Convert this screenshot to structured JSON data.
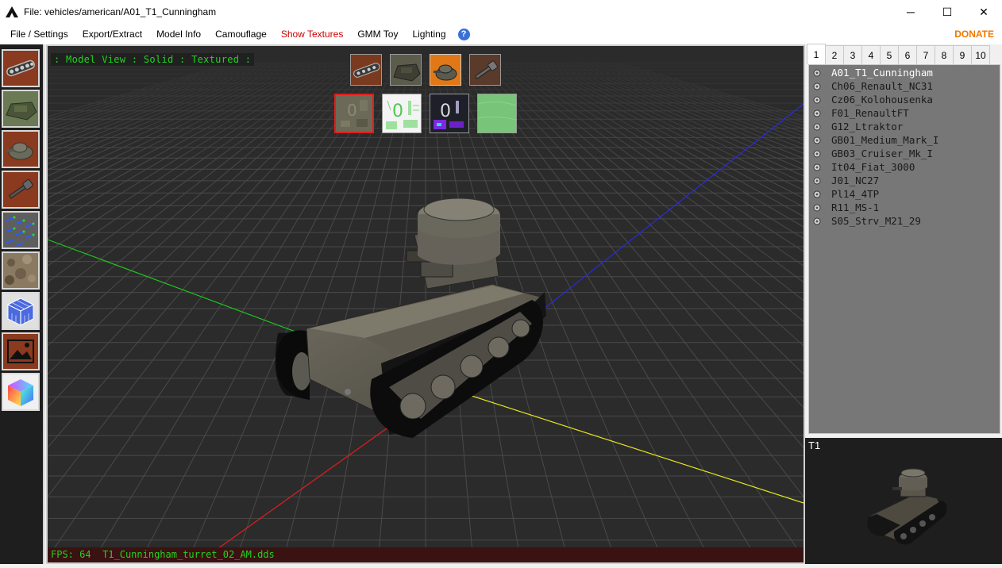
{
  "window": {
    "title": "File: vehicles/american/A01_T1_Cunningham",
    "minimize": "─",
    "maximize": "☐",
    "close": "✕"
  },
  "menu": {
    "items": [
      "File / Settings",
      "Export/Extract",
      "Model Info",
      "Camouflage",
      "Show Textures",
      "GMM Toy",
      "Lighting"
    ],
    "active": "Show Textures",
    "help_glyph": "?",
    "donate": "DONATE"
  },
  "toolbar": {
    "buttons": [
      "chassis-icon",
      "hull-icon",
      "turret-icon",
      "gun-icon",
      "normals-icon",
      "terrain-icon",
      "cube-grid-icon",
      "picture-icon",
      "color-cube-icon"
    ]
  },
  "viewport": {
    "mode_label": ": Model View : Solid : Textured :",
    "fps_label": "FPS:",
    "fps_value": "64",
    "texture_file": "T1_Cunningham_turret_02_AM.dds",
    "part_thumbs": [
      "chassis-thumb",
      "hull-thumb",
      "turret-thumb",
      "gun-thumb"
    ],
    "texture_thumbs": [
      "diffuse-texture",
      "normal-texture",
      "gmm-texture",
      "ao-texture"
    ],
    "selected_part": "turret-thumb",
    "selected_texture": "diffuse-texture"
  },
  "tabs": [
    "1",
    "2",
    "3",
    "4",
    "5",
    "6",
    "7",
    "8",
    "9",
    "10"
  ],
  "active_tab": "1",
  "tanks": [
    "A01_T1_Cunningham",
    "Ch06_Renault_NC31",
    "Cz06_Kolohousenka",
    "F01_RenaultFT",
    "G12_Ltraktor",
    "GB01_Medium_Mark_I",
    "GB03_Cruiser_Mk_I",
    "It04_Fiat_3000",
    "J01_NC27",
    "Pl14_4TP",
    "R11_MS-1",
    "S05_Strv_M21_29"
  ],
  "selected_tank": "A01_T1_Cunningham",
  "preview": {
    "title": "T1"
  },
  "colors": {
    "accent_selected": "#cc0000",
    "donate": "#f07800",
    "overlay_text": "#1fd41f",
    "toolbar_button_bg": "#8a3a1e",
    "axis_x": "#e01e1e",
    "axis_y": "#1fc41f",
    "axis_z": "#2a2ae0",
    "axis_yellow": "#e6e61e"
  }
}
